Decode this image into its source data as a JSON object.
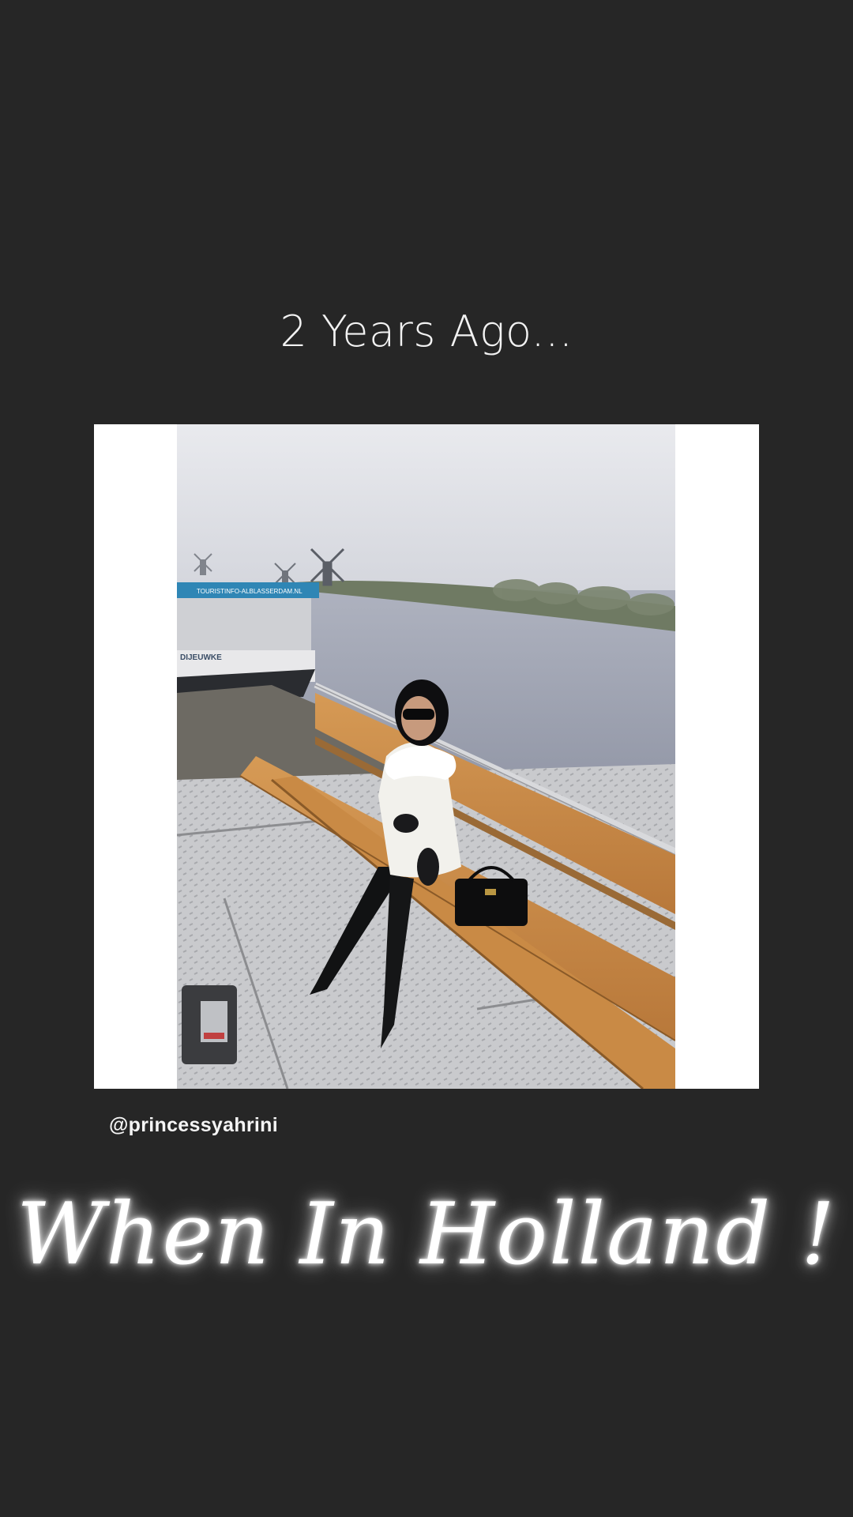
{
  "story": {
    "header_text": "2 Years Ago...",
    "caption_text": "When In Holland !",
    "username": "@princessyahrini",
    "background_color": "#262626"
  },
  "photo": {
    "boat_sign_text": "TOURISTINFO-ALBLASSERDAM.NL",
    "boat_name_text": "DIJEUWKE"
  }
}
